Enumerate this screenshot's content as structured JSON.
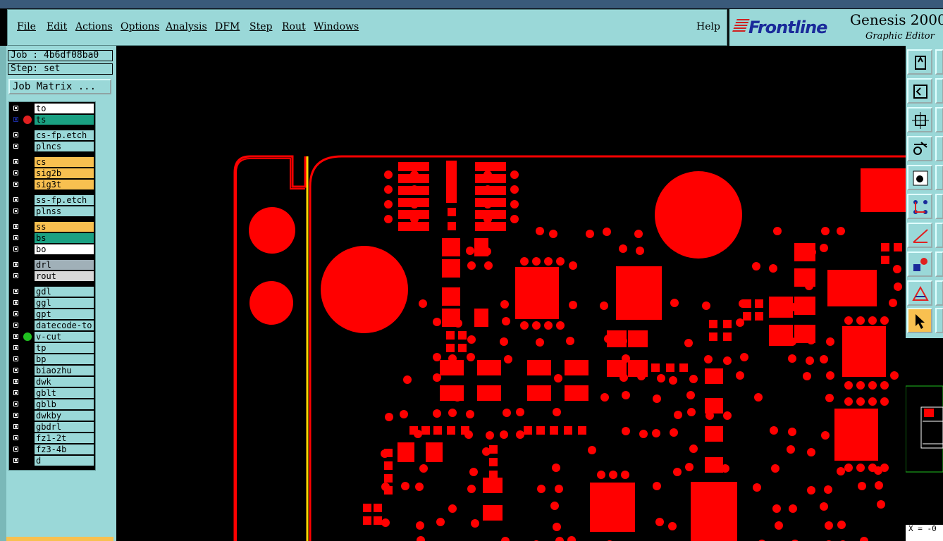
{
  "menu": {
    "items": [
      "File",
      "Edit",
      "Actions",
      "Options",
      "Analysis",
      "DFM",
      "Step",
      "Rout",
      "Windows"
    ],
    "help": "Help"
  },
  "brand": {
    "logo": "Frontline",
    "title": "Genesis 2000",
    "subtitle": "Graphic Editor"
  },
  "job": {
    "line": "Job : 4b6df08ba0",
    "step": "Step: set"
  },
  "job_matrix_label": "Job Matrix ...",
  "layers": [
    {
      "name": "to",
      "color": "#ffffff",
      "dot": ""
    },
    {
      "name": "ts",
      "color": "#1aa082",
      "dot": "#e02020",
      "selected": true
    },
    {
      "name": "cs-fp.etch",
      "color": "#9ad8d8",
      "dot": ""
    },
    {
      "name": "plncs",
      "color": "#9ad8d8",
      "dot": ""
    },
    {
      "name": "cs",
      "color": "#f8c050",
      "dot": ""
    },
    {
      "name": "sig2b",
      "color": "#f8c050",
      "dot": ""
    },
    {
      "name": "sig3t",
      "color": "#f8c050",
      "dot": ""
    },
    {
      "name": "ss-fp.etch",
      "color": "#9ad8d8",
      "dot": ""
    },
    {
      "name": "plnss",
      "color": "#9ad8d8",
      "dot": ""
    },
    {
      "name": "ss",
      "color": "#f8c050",
      "dot": ""
    },
    {
      "name": "bs",
      "color": "#1aa082",
      "dot": ""
    },
    {
      "name": "bo",
      "color": "#ffffff",
      "dot": ""
    },
    {
      "name": "drl",
      "color": "#a0b0b8",
      "dot": ""
    },
    {
      "name": "rout",
      "color": "#d8d8d8",
      "dot": ""
    },
    {
      "name": "gdl",
      "color": "#9ad8d8",
      "dot": ""
    },
    {
      "name": "ggl",
      "color": "#9ad8d8",
      "dot": ""
    },
    {
      "name": "gpt",
      "color": "#9ad8d8",
      "dot": ""
    },
    {
      "name": "datecode-to",
      "color": "#9ad8d8",
      "dot": ""
    },
    {
      "name": "v-cut",
      "color": "#9ad8d8",
      "dot": "#20c020"
    },
    {
      "name": "tp",
      "color": "#9ad8d8",
      "dot": ""
    },
    {
      "name": "bp",
      "color": "#9ad8d8",
      "dot": ""
    },
    {
      "name": "biaozhu",
      "color": "#9ad8d8",
      "dot": ""
    },
    {
      "name": "dwk",
      "color": "#9ad8d8",
      "dot": ""
    },
    {
      "name": "gblt",
      "color": "#9ad8d8",
      "dot": ""
    },
    {
      "name": "gblb",
      "color": "#9ad8d8",
      "dot": ""
    },
    {
      "name": "dwkby",
      "color": "#9ad8d8",
      "dot": ""
    },
    {
      "name": "gbdrl",
      "color": "#9ad8d8",
      "dot": ""
    },
    {
      "name": "fz1-2t",
      "color": "#9ad8d8",
      "dot": ""
    },
    {
      "name": "fz3-4b",
      "color": "#9ad8d8",
      "dot": ""
    },
    {
      "name": "d",
      "color": "#9ad8d8",
      "dot": ""
    }
  ],
  "tools": [
    "paste-icon",
    "fit-icon",
    "zoom-home-icon",
    "snap-icon",
    "select-pad-icon",
    "net-icon",
    "measure-icon",
    "feature-icon",
    "drc-icon",
    "pointer-icon"
  ],
  "coord_readout": "X = -0",
  "colors": {
    "pad": "#ff0000",
    "board_outline": "#ff0000",
    "vcut_line": "#ffd700",
    "panel": "#9ad8d8"
  }
}
